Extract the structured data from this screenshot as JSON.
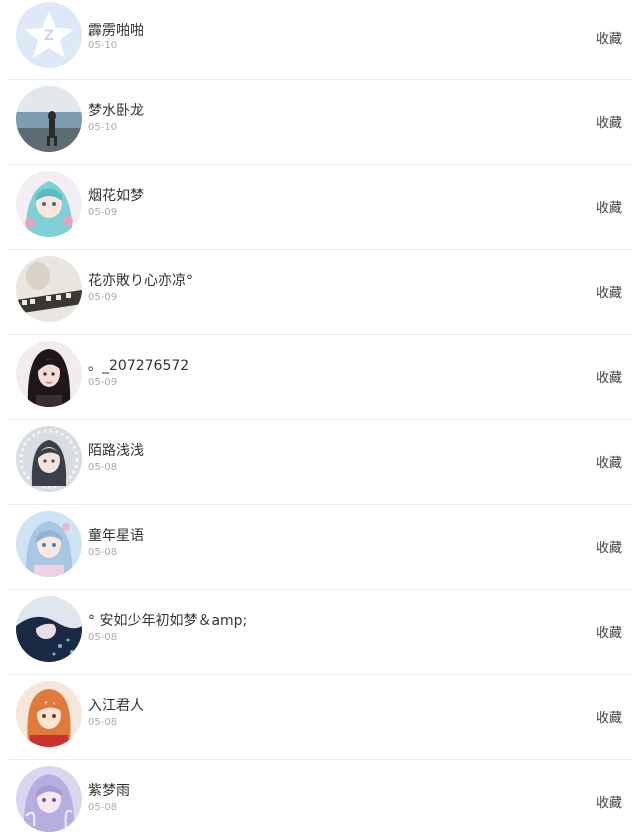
{
  "list": {
    "items": [
      {
        "name": "霹雳啪啪",
        "date": "05-10",
        "action": "收藏",
        "avatar": "qq-default-avatar"
      },
      {
        "name": "梦水卧龙",
        "date": "05-10",
        "action": "收藏",
        "avatar": "beach-figure-avatar"
      },
      {
        "name": "烟花如梦",
        "date": "05-09",
        "action": "收藏",
        "avatar": "anime-girl-avatar"
      },
      {
        "name": "花亦敗り心亦凉°",
        "date": "05-09",
        "action": "收藏",
        "avatar": "text-photo-avatar"
      },
      {
        "name": "。_207276572",
        "date": "05-09",
        "action": "收藏",
        "avatar": "girl-photo-avatar"
      },
      {
        "name": "陌路浅浅",
        "date": "05-08",
        "action": "收藏",
        "avatar": "anime-dark-avatar"
      },
      {
        "name": "童年星语",
        "date": "05-08",
        "action": "收藏",
        "avatar": "anime-blue-avatar"
      },
      {
        "name": "° 安如少年初如梦＆amp;",
        "date": "05-08",
        "action": "收藏",
        "avatar": "dark-blue-avatar"
      },
      {
        "name": "入江君人",
        "date": "05-08",
        "action": "收藏",
        "avatar": "anime-orange-avatar"
      },
      {
        "name": "紫梦雨",
        "date": "05-08",
        "action": "收藏",
        "avatar": "anime-purple-avatar"
      }
    ]
  }
}
